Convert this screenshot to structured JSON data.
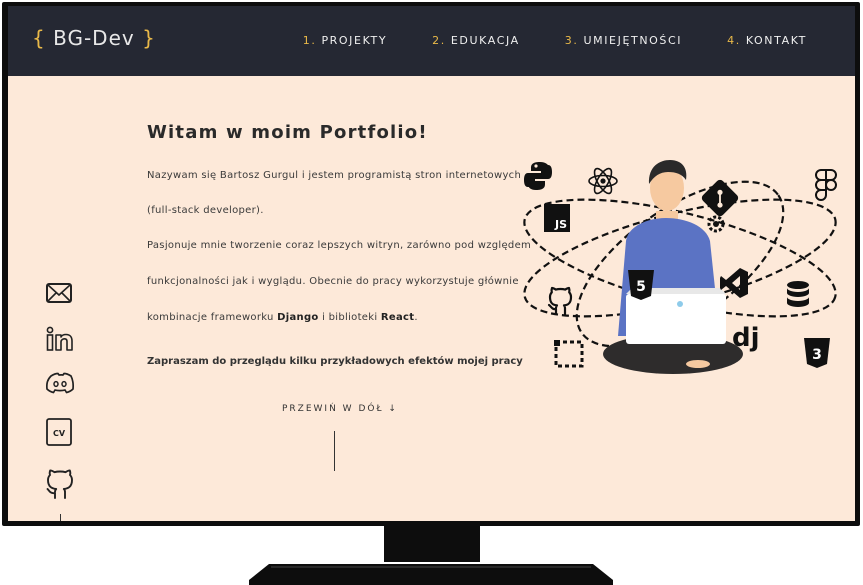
{
  "brand": {
    "open_brace": "{",
    "name": "BG-Dev",
    "close_brace": "}",
    "accent": "#e9b949"
  },
  "nav": [
    {
      "num": "1.",
      "label": "PROJEKTY"
    },
    {
      "num": "2.",
      "label": "EDUKACJA"
    },
    {
      "num": "3.",
      "label": "UMIEJĘTNOŚCI"
    },
    {
      "num": "4.",
      "label": "KONTAKT"
    }
  ],
  "hero": {
    "title": "Witam w moim Portfolio!",
    "lines": [
      "Nazywam się Bartosz Gurgul i jestem programistą stron internetowych",
      "(full-stack developer).",
      "Pasjonuje mnie tworzenie coraz lepszych witryn, zarówno pod względem",
      "funkcjonalności jak i wyglądu. Obecnie do pracy wykorzystuje głównie"
    ],
    "line5_prefix": "kombinacje frameworku ",
    "line5_django": "Django",
    "line5_middle": " i biblioteki ",
    "line5_react": "React",
    "line5_suffix": ".",
    "cta": "Zapraszam do przeglądu kilku przykładowych efektów mojej pracy",
    "scroll_hint": "PRZEWIŃ W DÓŁ ↓"
  },
  "socials": [
    {
      "icon": "mail-icon"
    },
    {
      "icon": "linkedin-icon"
    },
    {
      "icon": "discord-icon"
    },
    {
      "icon": "cv-icon",
      "text": "CV"
    },
    {
      "icon": "github-icon"
    }
  ],
  "illustration": {
    "icons": [
      "python-icon",
      "react-icon",
      "javascript-icon",
      "git-icon",
      "settings-icon",
      "figma-icon",
      "html5-icon",
      "vscode-icon",
      "database-icon",
      "github-icon",
      "django-icon",
      "css3-icon",
      "selection-icon"
    ],
    "labels": {
      "js": "JS",
      "html": "5",
      "css": "3",
      "dj": "dj"
    },
    "shirt_color": "#5b73c4",
    "skin_color": "#f6c9a0",
    "hair_color": "#2a2a2a",
    "pants_color": "#2e2c2c"
  },
  "colors": {
    "navbar": "#252833",
    "page_bg": "#fde9d9",
    "frame": "#0d0d0d"
  }
}
